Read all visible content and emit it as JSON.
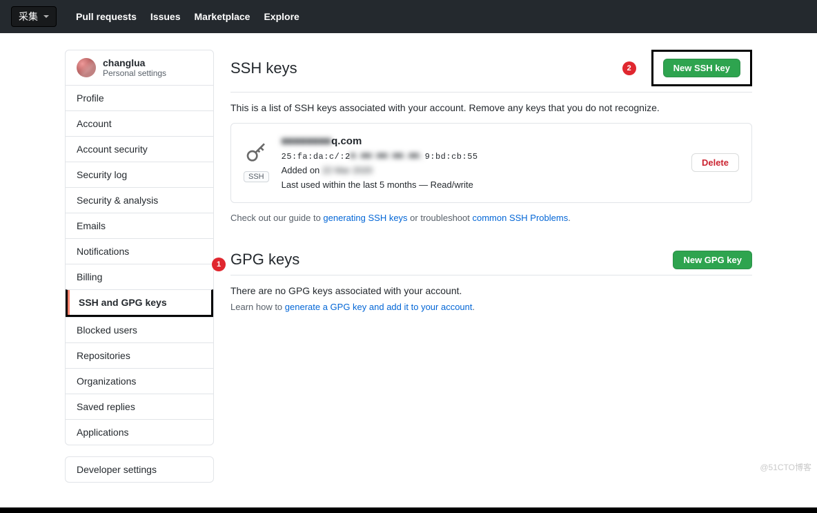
{
  "topbar": {
    "collect_label": "采集",
    "nav": [
      "Pull requests",
      "Issues",
      "Marketplace",
      "Explore"
    ]
  },
  "sidebar": {
    "username": "changlua",
    "subtitle": "Personal settings",
    "items": [
      "Profile",
      "Account",
      "Account security",
      "Security log",
      "Security & analysis",
      "Emails",
      "Notifications",
      "Billing",
      "SSH and GPG keys",
      "Blocked users",
      "Repositories",
      "Organizations",
      "Saved replies",
      "Applications"
    ],
    "developer": "Developer settings"
  },
  "annotations": {
    "badge1": "1",
    "badge2": "2"
  },
  "ssh": {
    "heading": "SSH keys",
    "new_btn": "New SSH key",
    "description": "This is a list of SSH keys associated with your account. Remove any keys that you do not recognize.",
    "key": {
      "title_hidden": "■■■■■■■■",
      "title_suffix": "q.com",
      "fingerprint_pre": "25:fa:da:c/:2",
      "fingerprint_mid": "■.■■:■■:■■.■■.",
      "fingerprint_post": "9:bd:cb:55",
      "added_pre": "Added on ",
      "added_hidden": "22 Mar 2020",
      "lastused": "Last used within the last 5 months — Read/write",
      "pill": "SSH",
      "delete": "Delete"
    },
    "note_pre": "Check out our guide to ",
    "note_link1": "generating SSH keys",
    "note_mid": " or troubleshoot ",
    "note_link2": "common SSH Problems",
    "note_end": "."
  },
  "gpg": {
    "heading": "GPG keys",
    "new_btn": "New GPG key",
    "none": "There are no GPG keys associated with your account.",
    "learn_pre": "Learn how to ",
    "learn_link": "generate a GPG key and add it to your account",
    "learn_end": "."
  },
  "watermark": "@51CTO博客"
}
